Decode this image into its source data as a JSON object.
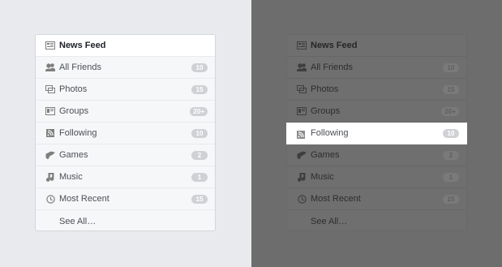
{
  "menu": {
    "header": {
      "label": "News Feed",
      "icon": "news-feed-icon"
    },
    "items": [
      {
        "label": "All Friends",
        "badge": "10",
        "icon": "friends-icon"
      },
      {
        "label": "Photos",
        "badge": "15",
        "icon": "photos-icon"
      },
      {
        "label": "Groups",
        "badge": "20+",
        "icon": "groups-icon"
      },
      {
        "label": "Following",
        "badge": "10",
        "icon": "following-icon"
      },
      {
        "label": "Games",
        "badge": "2",
        "icon": "games-icon"
      },
      {
        "label": "Music",
        "badge": "1",
        "icon": "music-icon"
      },
      {
        "label": "Most Recent",
        "badge": "15",
        "icon": "clock-icon"
      }
    ],
    "see_all": "See All…"
  },
  "highlighted": {
    "label": "Following",
    "badge": "10"
  },
  "colors": {
    "left_background": "#e9eaed",
    "right_overlay": "#6d6d6d",
    "badge": "#d0d1d5",
    "highlight": "#ffffff"
  }
}
